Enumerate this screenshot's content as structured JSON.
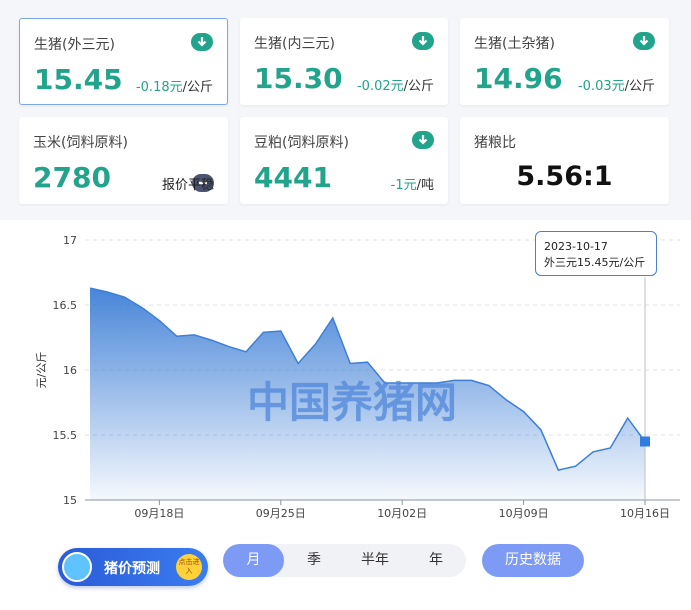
{
  "cards": [
    {
      "name": "生猪(外三元)",
      "price": "15.45",
      "change": "-0.18元",
      "unit": "/公斤",
      "trend_icon": "arrow-down-icon"
    },
    {
      "name": "生猪(内三元)",
      "price": "15.30",
      "change": "-0.02元",
      "unit": "/公斤",
      "trend_icon": "arrow-down-icon"
    },
    {
      "name": "生猪(土杂猪)",
      "price": "14.96",
      "change": "-0.03元",
      "unit": "/公斤",
      "trend_icon": "arrow-down-icon"
    },
    {
      "name": "玉米(饲料原料)",
      "price": "2780",
      "status": "报价平稳",
      "trend_icon": "minus-icon"
    },
    {
      "name": "豆粕(饲料原料)",
      "price": "4441",
      "change": "-1元",
      "unit": "/吨",
      "trend_icon": "arrow-down-icon"
    },
    {
      "name": "猪粮比",
      "ratio": "5.56:1"
    }
  ],
  "colors": {
    "up_down": "#22a38b",
    "accent": "#7d9bf5",
    "line": "#3e7fd6",
    "flat_badge": "#4c5570"
  },
  "chart_data": {
    "type": "area",
    "ylabel": "元/公斤",
    "ylim": [
      15,
      17
    ],
    "yticks": [
      "17",
      "16.5",
      "16",
      "15.5",
      "15"
    ],
    "xtick_labels": [
      "09月18日",
      "09月25日",
      "10月02日",
      "10月09日",
      "10月16日"
    ],
    "x": [
      "2023-09-14",
      "2023-09-15",
      "2023-09-16",
      "2023-09-17",
      "2023-09-18",
      "2023-09-19",
      "2023-09-20",
      "2023-09-21",
      "2023-09-22",
      "2023-09-23",
      "2023-09-24",
      "2023-09-25",
      "2023-09-26",
      "2023-09-27",
      "2023-09-28",
      "2023-09-29",
      "2023-09-30",
      "2023-10-01",
      "2023-10-02",
      "2023-10-03",
      "2023-10-04",
      "2023-10-05",
      "2023-10-06",
      "2023-10-07",
      "2023-10-08",
      "2023-10-09",
      "2023-10-10",
      "2023-10-11",
      "2023-10-12",
      "2023-10-13",
      "2023-10-14",
      "2023-10-15",
      "2023-10-16",
      "2023-10-17"
    ],
    "series": [
      {
        "values": [
          16.63,
          16.6,
          16.56,
          16.48,
          16.38,
          16.26,
          16.27,
          16.23,
          16.18,
          16.14,
          16.29,
          16.3,
          16.05,
          16.2,
          16.4,
          16.05,
          16.06,
          15.9,
          15.9,
          15.9,
          15.9,
          15.92,
          15.92,
          15.88,
          15.77,
          15.68,
          15.54,
          15.23,
          15.26,
          15.37,
          15.4,
          15.63,
          15.45
        ]
      }
    ],
    "grid": true
  },
  "tooltip": {
    "date": "2023-10-17",
    "text": "外三元15.45元/公斤"
  },
  "watermark": "中国养猪网",
  "promo": {
    "label": "猪价预测",
    "cta": "点击进入"
  },
  "periods": [
    "月",
    "季",
    "半年",
    "年"
  ],
  "active_period": "月",
  "history_label": "历史数据"
}
